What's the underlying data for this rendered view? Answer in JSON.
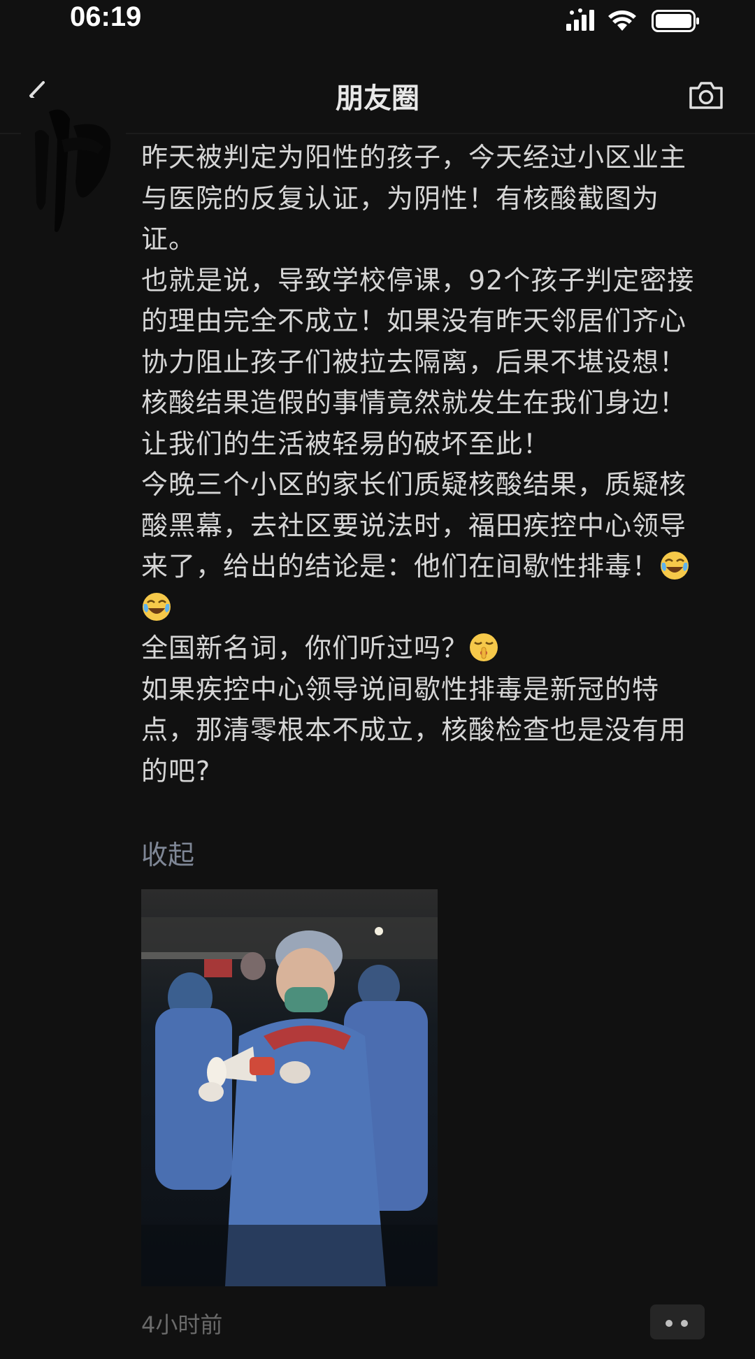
{
  "status_bar": {
    "time": "06:19"
  },
  "nav": {
    "title": "朋友圈"
  },
  "post": {
    "paragraphs": [
      "昨天被判定为阳性的孩子，今天经过小区业主与医院的反复认证，为阴性！有核酸截图为证。",
      "也就是说，导致学校停课，92个孩子判定密接的理由完全不成立！如果没有昨天邻居们齐心协力阻止孩子们被拉去隔离，后果不堪设想！",
      "核酸结果造假的事情竟然就发生在我们身边！让我们的生活被轻易的破坏至此！",
      "今晚三个小区的家长们质疑核酸结果，质疑核酸黑幕，去社区要说法时，福田疾控中心领导来了，给出的结论是：他们在间歇性排毒！"
    ],
    "line_new_term": "全国新名词，你们听过吗？",
    "last_paragraph": "如果疾控中心领导说间歇性排毒是新冠的特点，那清零根本不成立，核酸检查也是没有用的吧?",
    "collapse_label": "收起",
    "timestamp": "4小时前"
  },
  "icons": {
    "back": "chevron-left-icon",
    "camera": "camera-icon",
    "signal": "signal-icon",
    "wifi": "wifi-icon",
    "battery": "battery-icon",
    "more": "more-dots-icon",
    "emoji_laugh": "tears-of-joy-emoji",
    "emoji_shush": "shushing-face-emoji"
  },
  "colors": {
    "background": "#111111",
    "text": "#d6d6d6",
    "link": "#7f8796",
    "timestamp": "#6a6a6a"
  }
}
